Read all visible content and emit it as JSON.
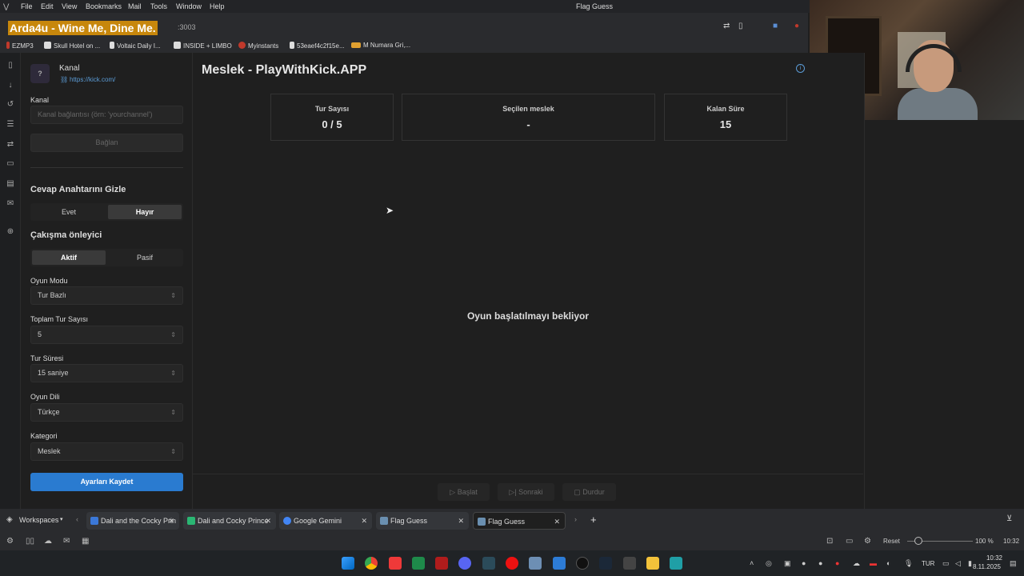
{
  "browser": {
    "menu": [
      "File",
      "Edit",
      "View",
      "Bookmarks",
      "Mail",
      "Tools",
      "Window",
      "Help"
    ],
    "window_title": "Flag Guess",
    "address_fragment": ":3003",
    "overlay_text": "Arda4u - Wine Me, Dine Me.",
    "bookmarks": [
      "EZMP3",
      "Skull Hotel on ...",
      "Voltaic Daily I...",
      "INSIDE + LIMBO",
      "Myinstants",
      "53eaef4c2f15e...",
      "M Numara Gri,..."
    ]
  },
  "sidebar": {
    "channel_badge": "?",
    "channel_title": "Kanal",
    "channel_link": "https://kick.com/",
    "kanal_label": "Kanal",
    "kanal_placeholder": "Kanal bağlantısı (örn: 'yourchannel')",
    "connect_label": "Bağlan",
    "hide_answer_title": "Cevap Anahtarını Gizle",
    "hide_answer_options": [
      "Evet",
      "Hayır"
    ],
    "conflict_title": "Çakışma önleyici",
    "conflict_options": [
      "Aktif",
      "Pasif"
    ],
    "game_mode_label": "Oyun Modu",
    "game_mode_value": "Tur Bazlı",
    "total_rounds_label": "Toplam Tur Sayısı",
    "total_rounds_value": "5",
    "round_time_label": "Tur Süresi",
    "round_time_value": "15 saniye",
    "language_label": "Oyun Dili",
    "language_value": "Türkçe",
    "category_label": "Kategori",
    "category_value": "Meslek",
    "save_label": "Ayarları Kaydet"
  },
  "main": {
    "title": "Meslek - PlayWithKick.APP",
    "cards": [
      {
        "title": "Tur Sayısı",
        "value": "0 / 5"
      },
      {
        "title": "Seçilen meslek",
        "value": "-"
      },
      {
        "title": "Kalan Süre",
        "value": "15"
      }
    ],
    "waiting_text": "Oyun başlatılmayı bekliyor",
    "controls": [
      "Başlat",
      "Sonraki",
      "Durdur"
    ]
  },
  "tabbar": {
    "workspaces_label": "Workspaces",
    "tabs": [
      "Dali and the Cocky Prin",
      "Dali and Cocky Prince",
      "Google Gemini",
      "Flag Guess",
      "Flag Guess"
    ]
  },
  "statusbar": {
    "reset_label": "Reset",
    "zoom": "100 %",
    "time": "10:32"
  },
  "taskbar": {
    "lang": "TUR",
    "time": "10:32",
    "date": "8.11.2025"
  },
  "colors": {
    "accent": "#2a7bd0",
    "overlay_bg": "#c7870c",
    "background": "#1f1f1f"
  }
}
